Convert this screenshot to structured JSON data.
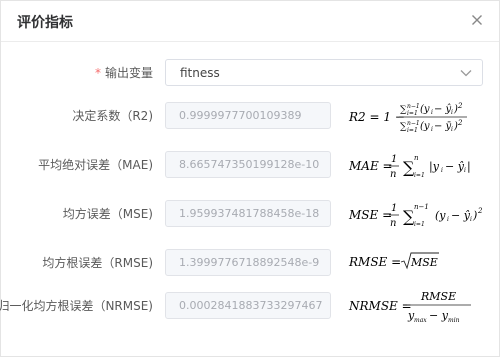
{
  "dialog": {
    "title": "评价指标"
  },
  "fields": {
    "output": {
      "label": "输出变量",
      "required_mark": "*",
      "value": "fitness"
    },
    "r2": {
      "label": "决定系数（R2)",
      "value": "0.9999977700109389"
    },
    "mae": {
      "label": "平均绝对误差（MAE)",
      "value": "8.665747350199128e-10"
    },
    "mse": {
      "label": "均方误差（MSE)",
      "value": "1.959937481788458e-18"
    },
    "rmse": {
      "label": "均方根误差（RMSE)",
      "value": "1.399977671889254​8e-9"
    },
    "nrmse": {
      "label": "归一化均方根误差（NRMSE)",
      "value": "0.0002841883733297467"
    }
  },
  "formulas": {
    "r2": "R2 = 1 − Σ(yi − ŷi)² / Σ(yi − ȳi)²",
    "mae": "MAE = (1/n) Σ |yi − ŷi|",
    "mse": "MSE = (1/n) Σ (yi − ŷi)²",
    "rmse": "RMSE = √MSE",
    "nrmse": "NRMSE = RMSE / (ymax − ymin)"
  }
}
